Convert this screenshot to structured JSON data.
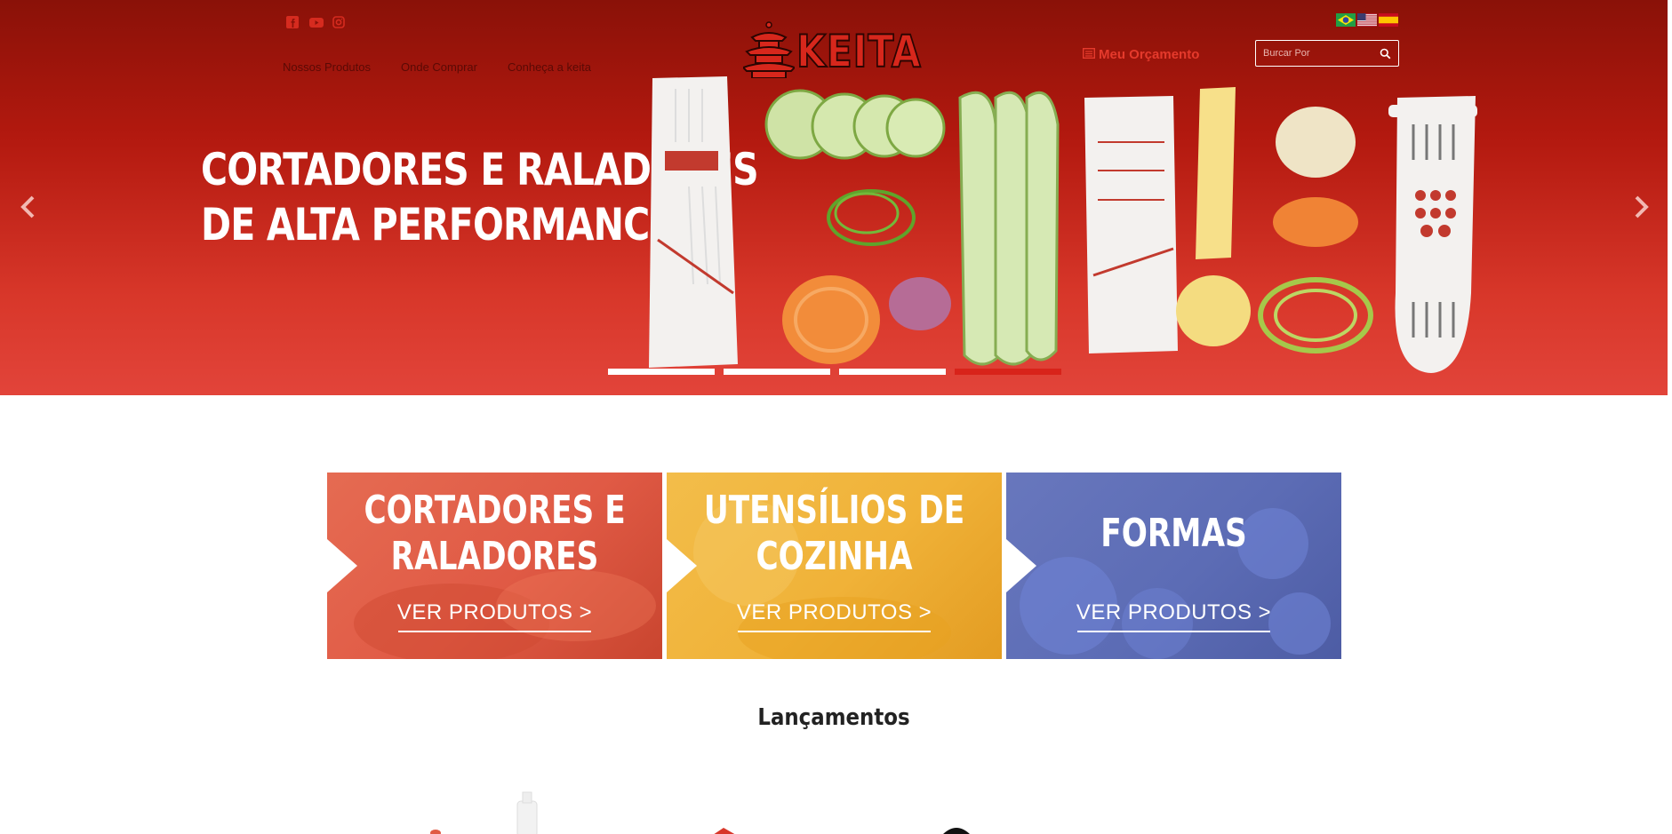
{
  "hero": {
    "title_line1": "CORTADORES E RALADORES",
    "title_line2": "DE ALTA PERFORMANCE",
    "slides": 4,
    "active_slide": 4
  },
  "social": {
    "icons": [
      "facebook-icon",
      "youtube-icon",
      "instagram-icon"
    ]
  },
  "nav": {
    "items": [
      {
        "label": "Nossos Produtos"
      },
      {
        "label": "Onde Comprar"
      },
      {
        "label": "Conheça a keita"
      }
    ]
  },
  "logo": {
    "text": "KEITA"
  },
  "header": {
    "orcamento_label": "Meu Orçamento"
  },
  "search": {
    "placeholder": "Burcar Por"
  },
  "languages": [
    "pt-BR",
    "en-US",
    "es"
  ],
  "tiles": [
    {
      "title_line1": "CORTADORES E",
      "title_line2": "RALADORES",
      "link": "VER PRODUTOS >",
      "color": "#e05a45"
    },
    {
      "title_line1": "UTENSÍLIOS DE",
      "title_line2": "COZINHA",
      "link": "VER PRODUTOS >",
      "color": "#f0b238"
    },
    {
      "title_line1": "FORMAS",
      "title_line2": "",
      "link": "VER PRODUTOS >",
      "color": "#5c6cb5"
    }
  ],
  "sections": {
    "lancamentos_title": "Lançamentos"
  },
  "colors": {
    "brand_red": "#d8231a",
    "hero_dark": "#8a1108"
  }
}
